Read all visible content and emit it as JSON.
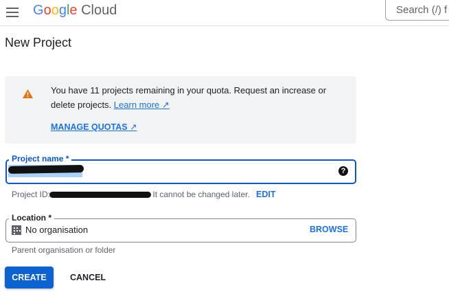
{
  "header": {
    "logo_google": [
      "G",
      "o",
      "o",
      "g",
      "l",
      "e"
    ],
    "logo_cloud": "Cloud",
    "search_placeholder": "Search (/) f"
  },
  "page": {
    "title": "New Project"
  },
  "alert": {
    "message": "You have 11 projects remaining in your quota. Request an increase or delete projects.",
    "learn_more": "Learn more",
    "manage_quotas": "MANAGE QUOTAS"
  },
  "form": {
    "project_name_label": "Project name *",
    "project_name_value": "",
    "help_icon": "?",
    "project_id_prefix": "Project ID:",
    "project_id_suffix": "It cannot be changed later.",
    "edit_label": "EDIT",
    "location_label": "Location *",
    "location_value": "No organisation",
    "browse_label": "BROWSE",
    "location_helper": "Parent organisation or folder"
  },
  "actions": {
    "create": "CREATE",
    "cancel": "CANCEL"
  },
  "colors": {
    "primary": "#0b57d0",
    "link": "#1a73e8",
    "warning": "#e8710a"
  }
}
